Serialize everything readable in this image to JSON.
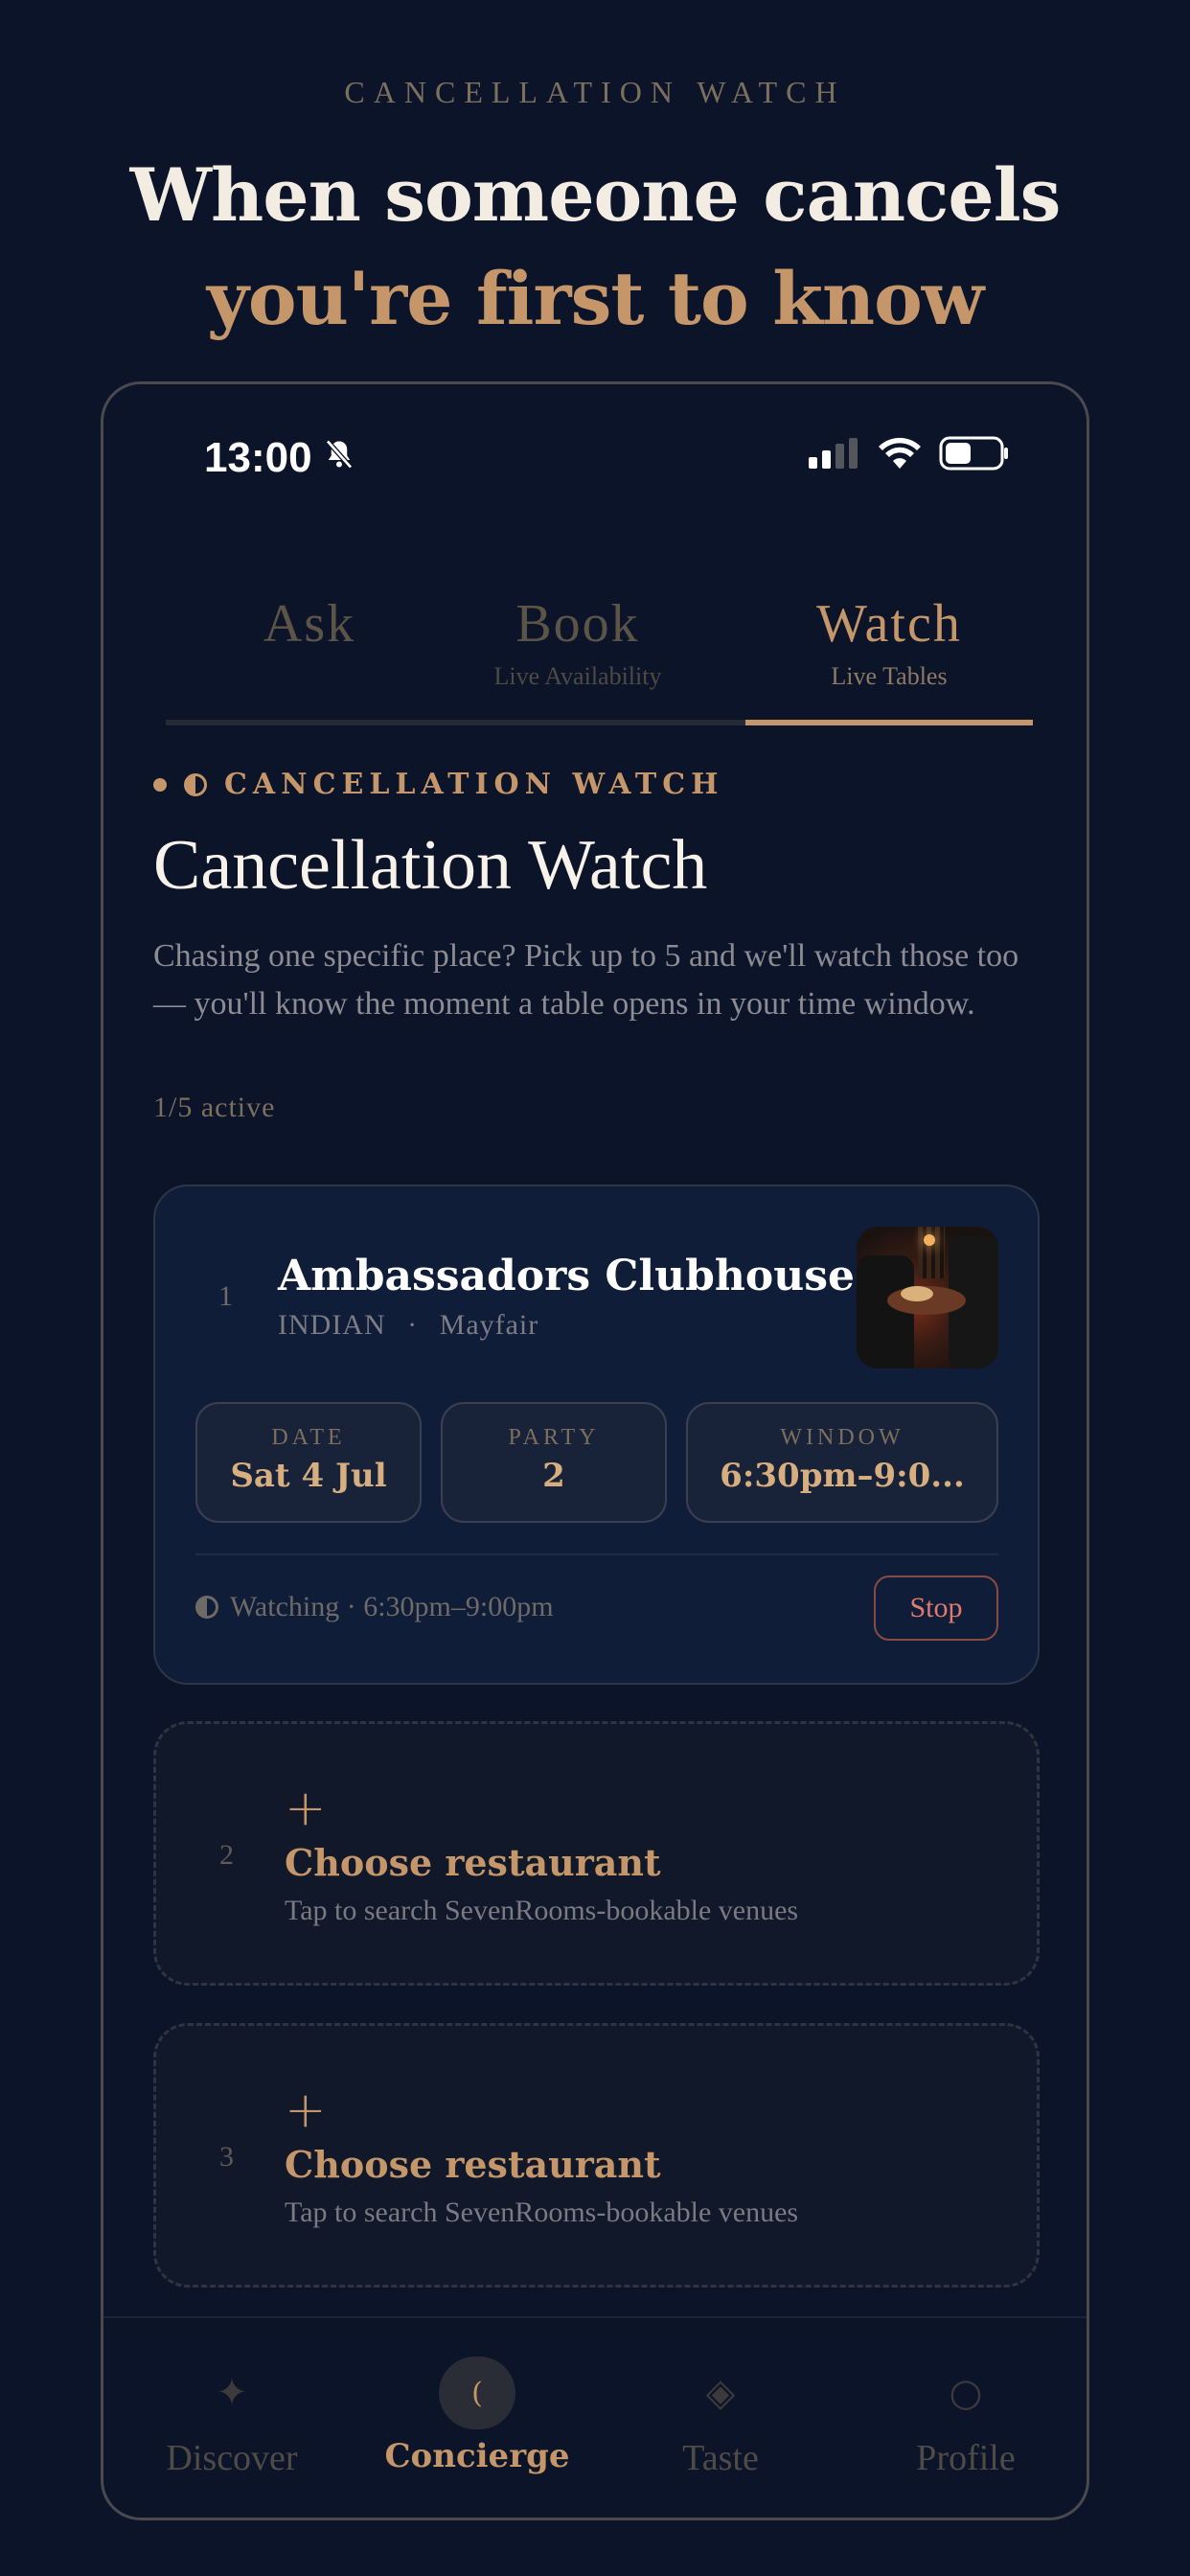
{
  "hero": {
    "eyebrow": "CANCELLATION  WATCH",
    "headline_line1": "When someone cancels",
    "headline_line2": "you're first to know"
  },
  "status_bar": {
    "time": "13:00"
  },
  "tabs": [
    {
      "label": "Ask",
      "sublabel": ""
    },
    {
      "label": "Book",
      "sublabel": "Live Availability"
    },
    {
      "label": "Watch",
      "sublabel": "Live Tables",
      "active": true
    }
  ],
  "section": {
    "kicker": "CANCELLATION WATCH",
    "title": "Cancellation Watch",
    "description": "Chasing one specific place? Pick up to 5 and we'll watch those too — you'll know the moment a table opens in your time window.",
    "active_count": "1/5 active"
  },
  "watch_card": {
    "number": "1",
    "restaurant": "Ambassadors Clubhouse",
    "cuisine": "INDIAN",
    "separator": "·",
    "area": "Mayfair",
    "date_label": "DATE",
    "date_value": "Sat 4 Jul",
    "party_label": "PARTY",
    "party_value": "2",
    "window_label": "WINDOW",
    "window_value": "6:30pm–9:0...",
    "status": "Watching · 6:30pm–9:00pm",
    "stop_label": "Stop"
  },
  "empty_slots": [
    {
      "number": "2",
      "plus": "+",
      "title": "Choose restaurant",
      "subtitle": "Tap to search SevenRooms-bookable venues"
    },
    {
      "number": "3",
      "plus": "+",
      "title": "Choose restaurant",
      "subtitle": "Tap to search SevenRooms-bookable venues"
    }
  ],
  "bottom_nav": [
    {
      "label": "Discover",
      "icon": "sparkle-icon",
      "glyph": "✦"
    },
    {
      "label": "Concierge",
      "icon": "moon-icon",
      "glyph": "(",
      "active": true
    },
    {
      "label": "Taste",
      "icon": "diamond-icon",
      "glyph": "◈"
    },
    {
      "label": "Profile",
      "icon": "circle-icon",
      "glyph": "○"
    }
  ],
  "colors": {
    "background": "#0b1428",
    "accent_gold": "#c4966a",
    "stop_red": "#e07a6e",
    "card_bg": "#101d38"
  }
}
